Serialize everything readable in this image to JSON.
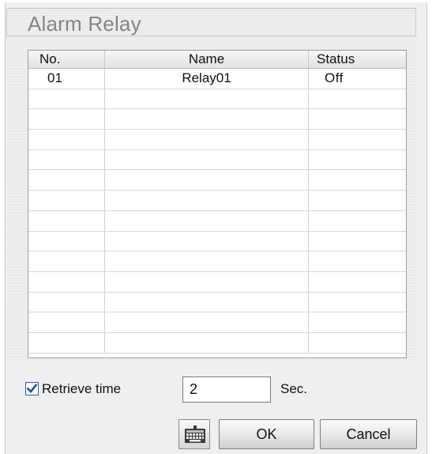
{
  "dialog": {
    "title": "Alarm Relay"
  },
  "table": {
    "columns": [
      "No.",
      "Name",
      "Status"
    ],
    "rows": [
      {
        "no": "01",
        "name": "Relay01",
        "status": "Off"
      },
      {
        "no": "",
        "name": "",
        "status": ""
      },
      {
        "no": "",
        "name": "",
        "status": ""
      },
      {
        "no": "",
        "name": "",
        "status": ""
      },
      {
        "no": "",
        "name": "",
        "status": ""
      },
      {
        "no": "",
        "name": "",
        "status": ""
      },
      {
        "no": "",
        "name": "",
        "status": ""
      },
      {
        "no": "",
        "name": "",
        "status": ""
      },
      {
        "no": "",
        "name": "",
        "status": ""
      },
      {
        "no": "",
        "name": "",
        "status": ""
      },
      {
        "no": "",
        "name": "",
        "status": ""
      },
      {
        "no": "",
        "name": "",
        "status": ""
      },
      {
        "no": "",
        "name": "",
        "status": ""
      },
      {
        "no": "",
        "name": "",
        "status": ""
      }
    ]
  },
  "retrieve": {
    "checked": true,
    "label": "Retrieve time",
    "value": "2",
    "unit": "Sec."
  },
  "buttons": {
    "icon": "keyboard-icon",
    "ok": "OK",
    "cancel": "Cancel"
  },
  "colors": {
    "check": "#1a4fa0",
    "table_border": "#8aa0bc",
    "title_text": "#858585"
  }
}
